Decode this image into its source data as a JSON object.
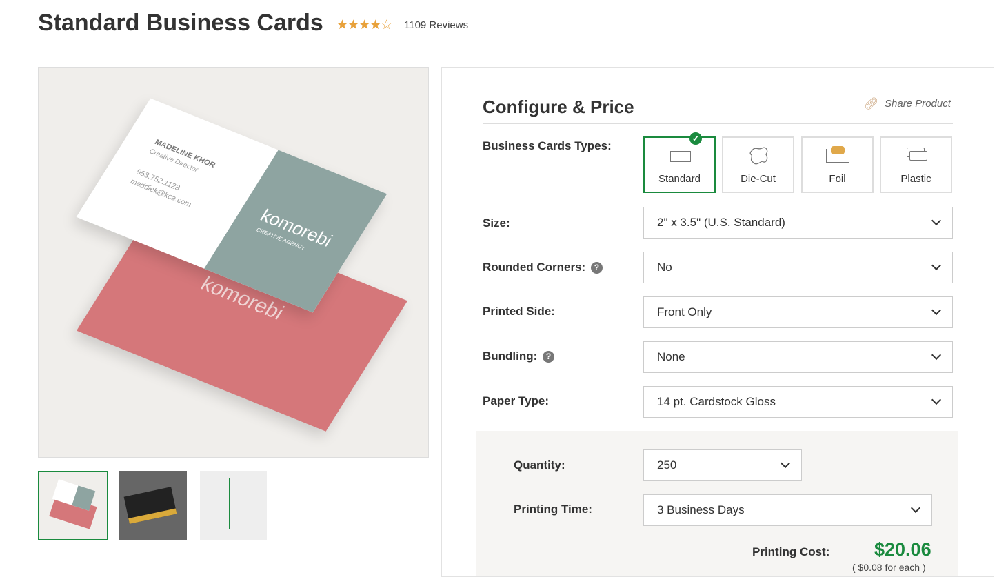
{
  "product": {
    "title": "Standard Business Cards",
    "stars": "★★★★☆",
    "rating": 4,
    "reviews": "1109 Reviews"
  },
  "image": {
    "card_name": "MADELINE KHOR",
    "card_role": "Creative Director",
    "card_phone": "953.752.1128",
    "card_email": "maddiek@kca.com",
    "brand": "komorebi",
    "brand_sub": "CREATIVE AGENCY"
  },
  "configure": {
    "heading": "Configure & Price",
    "share": "Share Product",
    "types_label": "Business Cards Types:",
    "types": [
      {
        "label": "Standard",
        "selected": true
      },
      {
        "label": "Die-Cut"
      },
      {
        "label": "Foil"
      },
      {
        "label": "Plastic"
      }
    ],
    "fields": [
      {
        "label": "Size:",
        "value": "2\" x 3.5\" (U.S. Standard)"
      },
      {
        "label": "Rounded Corners:",
        "value": "No",
        "help": true
      },
      {
        "label": "Printed Side:",
        "value": "Front Only"
      },
      {
        "label": "Bundling:",
        "value": "None",
        "help": true
      },
      {
        "label": "Paper Type:",
        "value": "14 pt. Cardstock Gloss"
      }
    ],
    "quantity_label": "Quantity:",
    "quantity": "250",
    "time_label": "Printing Time:",
    "time": "3 Business Days",
    "cost_label": "Printing Cost:",
    "cost": "$20.06",
    "each": "( $0.08 for each )"
  },
  "colors": {
    "accent": "#1a8a3e",
    "star": "#e8a13a"
  }
}
